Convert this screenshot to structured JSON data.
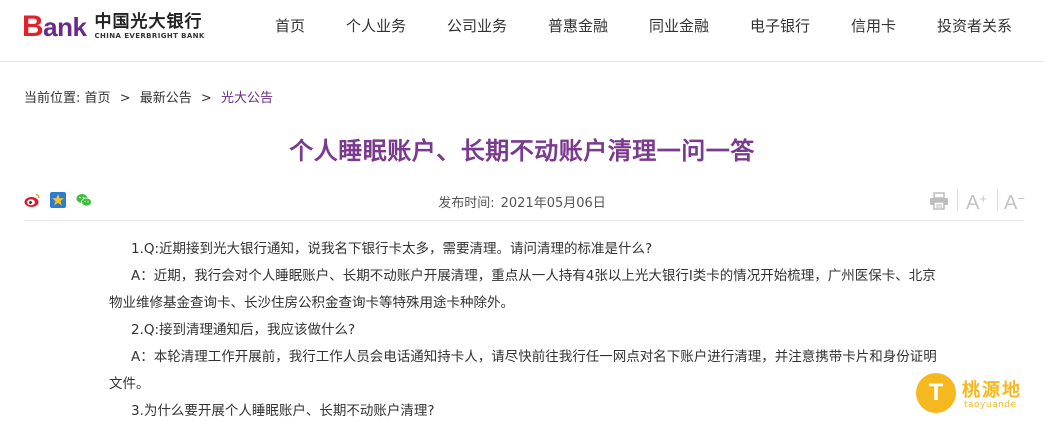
{
  "header": {
    "logo": {
      "bank_word_b": "B",
      "bank_word_rest": "ank",
      "name_cn": "中国光大银行",
      "name_en": "CHINA EVERBRIGHT BANK"
    },
    "nav": [
      "首页",
      "个人业务",
      "公司业务",
      "普惠金融",
      "同业金融",
      "电子银行",
      "信用卡",
      "投资者关系"
    ]
  },
  "breadcrumb": {
    "prefix": "当前位置:",
    "items": [
      "首页",
      "最新公告",
      "光大公告"
    ],
    "separator": ">"
  },
  "article": {
    "title": "个人睡眠账户、长期不动账户清理一问一答",
    "publish_label": "发布时间:",
    "publish_date": "2021年05月06日",
    "share_icons": [
      "weibo-icon",
      "qzone-star-icon",
      "wechat-icon"
    ],
    "tools": {
      "print_icon": "printer-icon",
      "font_increase": "A",
      "font_increase_sign": "+",
      "font_decrease": "A",
      "font_decrease_sign": "−"
    },
    "paragraphs": [
      "1.Q:近期接到光大银行通知，说我名下银行卡太多，需要清理。请问清理的标准是什么?",
      "A：近期，我行会对个人睡眠账户、长期不动账户开展清理，重点从一人持有4张以上光大银行Ⅰ类卡的情况开始梳理，广州医保卡、北京物业维修基金查询卡、长沙住房公积金查询卡等特殊用途卡种除外。",
      "2.Q:接到清理通知后，我应该做什么?",
      "A：本轮清理工作开展前，我行工作人员会电话通知持卡人，请尽快前往我行任一网点对名下账户进行清理，并注意携带卡片和身份证明文件。",
      "3.为什么要开展个人睡眠账户、长期不动账户清理?"
    ]
  },
  "watermark": {
    "glyph": "T",
    "name": "桃源地",
    "domain": "taoyuande"
  },
  "colors": {
    "brand_purple": "#7a3b8f",
    "brand_red": "#e0232a",
    "watermark_yellow": "#f6b81f"
  }
}
